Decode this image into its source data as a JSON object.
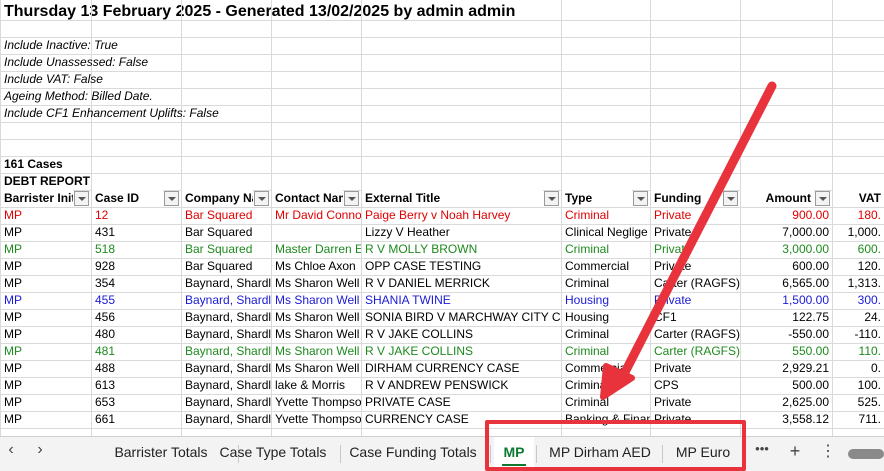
{
  "title": "Thursday 13 February 2025 - Generated 13/02/2025 by admin admin",
  "params": [
    "Include Inactive: True",
    "Include Unassessed: False",
    "Include VAT: False",
    "Ageing Method: Billed Date.",
    "Include CF1 Enhancement Uplifts: False"
  ],
  "cases_count": "161 Cases",
  "report_name": "DEBT REPORT",
  "headers": [
    "Barrister Init",
    "Case ID",
    "Company Na",
    "Contact Nam",
    "External Title",
    "Type",
    "Funding",
    "Amount",
    "VAT"
  ],
  "rows": [
    {
      "color": "#e00000",
      "cells": [
        "MP",
        "12",
        "Bar Squared",
        "Mr David Conno",
        "Paige Berry v Noah Harvey",
        "Criminal",
        "Private",
        "900.00",
        "180."
      ]
    },
    {
      "color": "#000000",
      "cells": [
        "MP",
        "431",
        "Bar Squared",
        "",
        "Lizzy V Heather",
        "Clinical Neglige",
        "Private",
        "7,000.00",
        "1,000."
      ]
    },
    {
      "color": "#1e8a1e",
      "cells": [
        "MP",
        "518",
        "Bar Squared",
        "Master Darren E",
        "R V MOLLY BROWN",
        "Criminal",
        "Private",
        "3,000.00",
        "600."
      ]
    },
    {
      "color": "#000000",
      "cells": [
        "MP",
        "928",
        "Bar Squared",
        "Ms Chloe Axon",
        "OPP CASE TESTING",
        "Commercial",
        "Private",
        "600.00",
        "120."
      ]
    },
    {
      "color": "#000000",
      "cells": [
        "MP",
        "354",
        "Baynard, Shardl",
        "Ms Sharon Well",
        "R V DANIEL MERRICK",
        "Criminal",
        "Carter (RAGFS)",
        "6,565.00",
        "1,313."
      ]
    },
    {
      "color": "#1a1ad6",
      "cells": [
        "MP",
        "455",
        "Baynard, Shardl",
        "Ms Sharon Well",
        "SHANIA TWINE",
        "Housing",
        "Private",
        "1,500.00",
        "300."
      ]
    },
    {
      "color": "#000000",
      "cells": [
        "MP",
        "456",
        "Baynard, Shardl",
        "Ms Sharon Well",
        "SONIA BIRD V MARCHWAY CITY CO",
        "Housing",
        "CF1",
        "122.75",
        "24."
      ]
    },
    {
      "color": "#000000",
      "cells": [
        "MP",
        "480",
        "Baynard, Shardl",
        "Ms Sharon Well",
        "R V JAKE COLLINS",
        "Criminal",
        "Carter (RAGFS)",
        "-550.00",
        "-110."
      ]
    },
    {
      "color": "#1e8a1e",
      "cells": [
        "MP",
        "481",
        "Baynard, Shardl",
        "Ms Sharon Well",
        "R V JAKE COLLINS",
        "Criminal",
        "Carter (RAGFS)",
        "550.00",
        "110."
      ]
    },
    {
      "color": "#000000",
      "cells": [
        "MP",
        "488",
        "Baynard, Shardl",
        "Ms Sharon Well",
        "DIRHAM CURRENCY CASE",
        "Commercial",
        "Private",
        "2,929.21",
        "0."
      ]
    },
    {
      "color": "#000000",
      "cells": [
        "MP",
        "613",
        "Baynard, Shardl",
        "lake & Morris",
        "R V ANDREW PENSWICK",
        "Criminal",
        "CPS",
        "500.00",
        "100."
      ]
    },
    {
      "color": "#000000",
      "cells": [
        "MP",
        "653",
        "Baynard, Shardl",
        "Yvette Thompso",
        "PRIVATE CASE",
        "Criminal",
        "Private",
        "2,625.00",
        "525."
      ]
    },
    {
      "color": "#000000",
      "cells": [
        "MP",
        "661",
        "Baynard, Shardl",
        "Yvette Thompso",
        "CURRENCY CASE",
        "Banking & Finan",
        "Private",
        "3,558.12",
        "711."
      ]
    }
  ],
  "tabs": [
    "Barrister Totals",
    "Case Type Totals",
    "Case Funding Totals",
    "MP",
    "MP Dirham AED",
    "MP Euro"
  ],
  "active_tab": "MP",
  "nav": {
    "prev": "‹",
    "next": "›",
    "more": "•••",
    "add": "+",
    "menu": "⋮"
  },
  "colors": {
    "accent": "#0e7a31",
    "highlight": "#e8333d"
  }
}
